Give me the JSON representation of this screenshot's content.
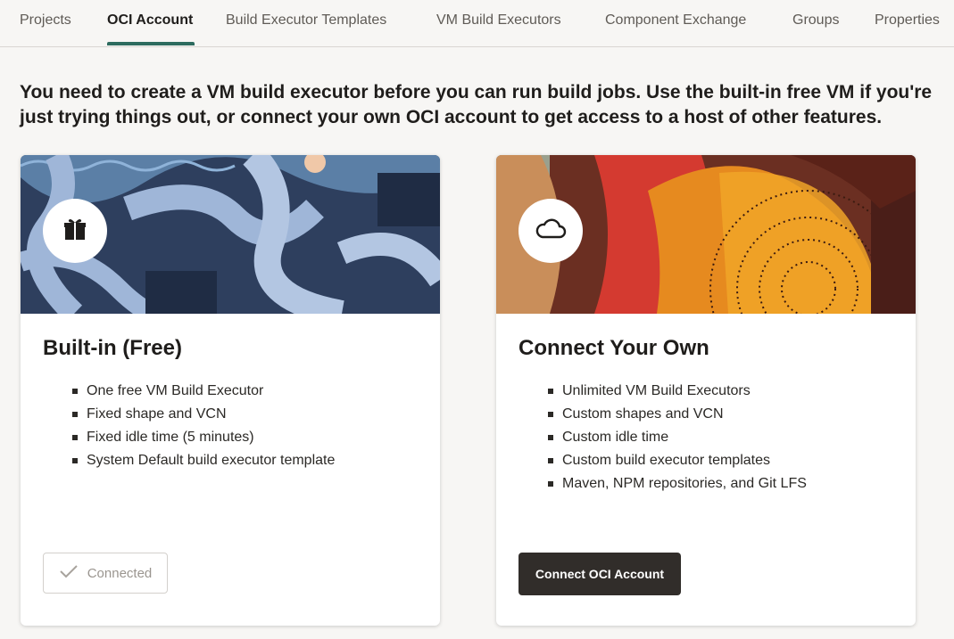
{
  "tabs": [
    {
      "label": "Projects"
    },
    {
      "label": "OCI Account",
      "active": true
    },
    {
      "label": "Build Executor Templates"
    },
    {
      "label": "VM Build Executors"
    },
    {
      "label": "Component Exchange"
    },
    {
      "label": "Groups"
    },
    {
      "label": "Properties"
    }
  ],
  "headline": "You need to create a VM build executor before you can run build jobs. Use the built-in free VM if you're just trying things out, or connect your own OCI account to get access to a host of other features.",
  "cards": [
    {
      "title": "Built-in (Free)",
      "icon": "gift-icon",
      "features": [
        "One free VM Build Executor",
        "Fixed shape and VCN",
        "Fixed idle time (5 minutes)",
        "System Default build executor template"
      ],
      "button": "Connected",
      "button_state": "disabled"
    },
    {
      "title": "Connect Your Own",
      "icon": "cloud-icon",
      "features": [
        "Unlimited VM Build Executors",
        "Custom shapes and VCN",
        "Custom idle time",
        "Custom build executor templates",
        "Maven, NPM repositories, and Git LFS"
      ],
      "button": "Connect OCI Account"
    }
  ],
  "colors": {
    "accent": "#2d6b5f",
    "primary_button": "#312d2a",
    "page_bg": "#f7f6f4"
  }
}
